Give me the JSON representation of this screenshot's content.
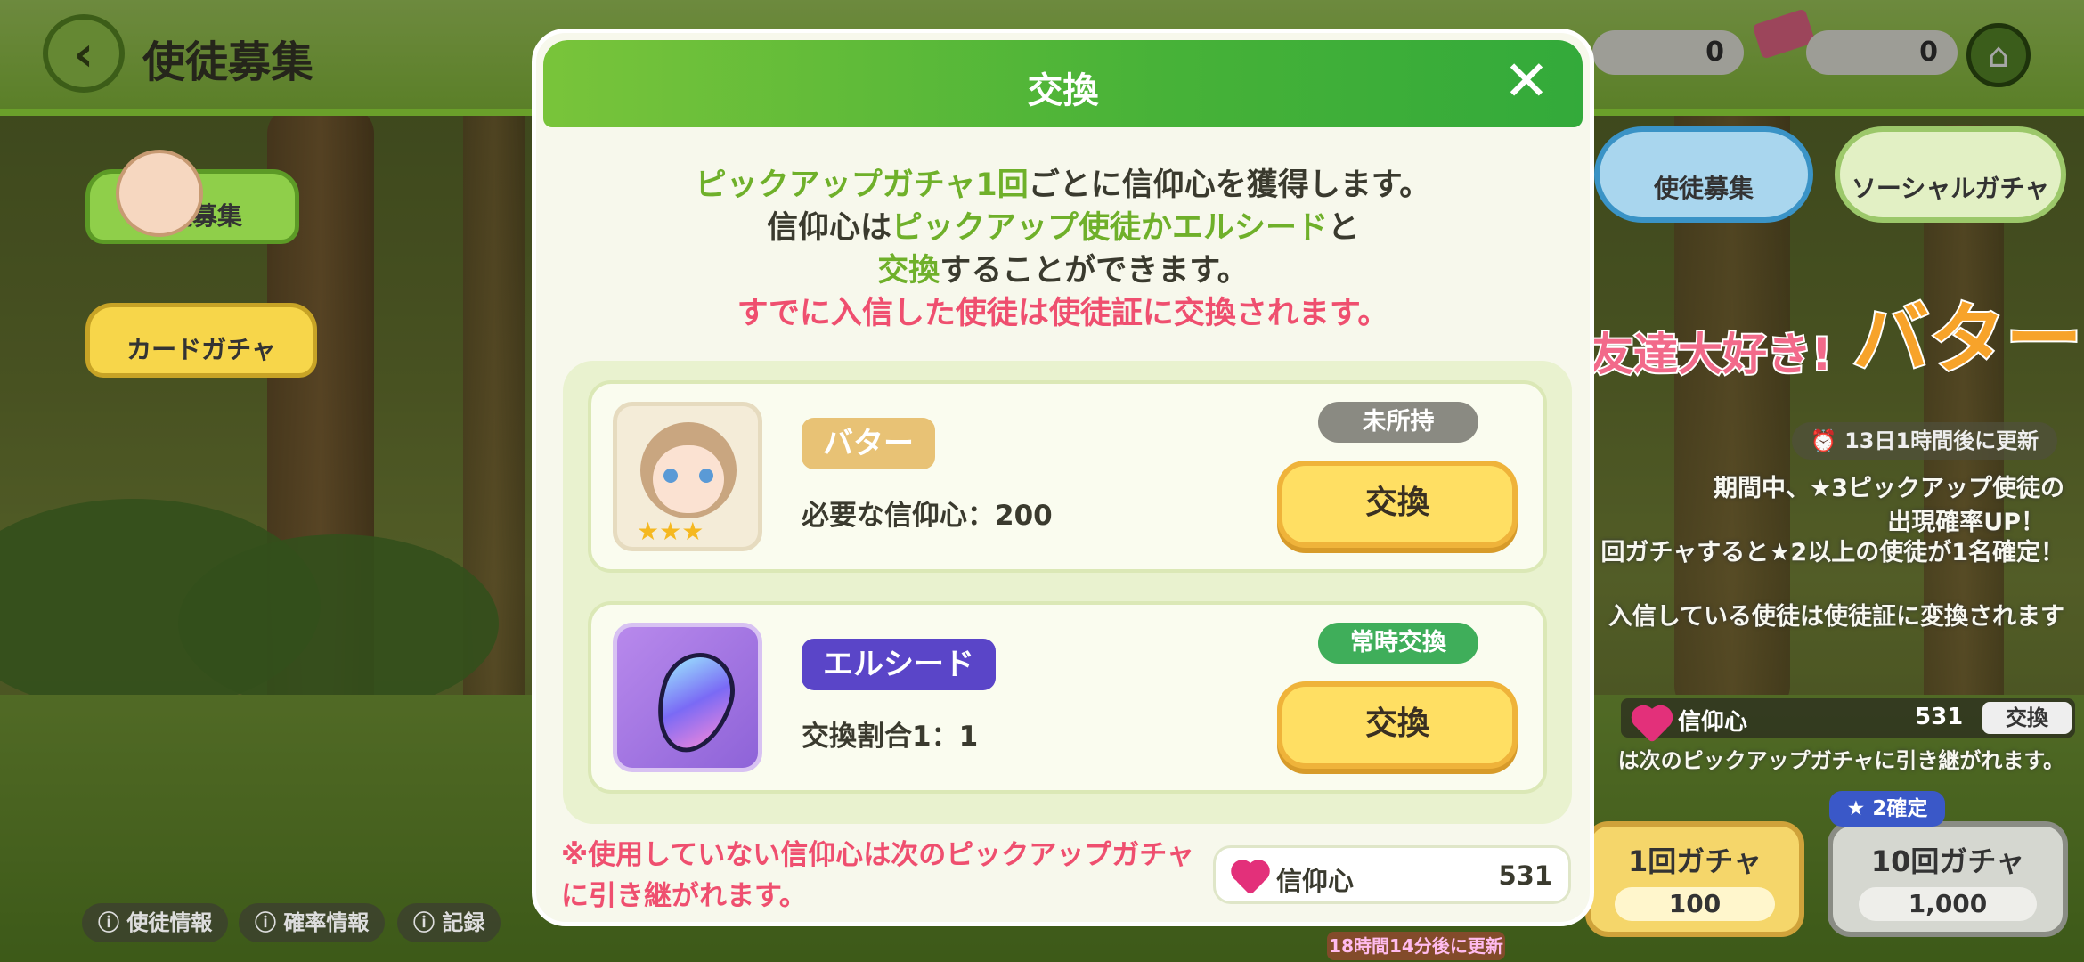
{
  "header": {
    "title": "使徒募集",
    "counters": [
      "0",
      "0"
    ]
  },
  "left_menu": {
    "recruit_label": "使徒募集",
    "card_gacha_label": "カードガチャ"
  },
  "right_tabs": {
    "recruit_label": "使徒募集",
    "social_label": "ソーシャルガチャ"
  },
  "banner": {
    "text_left": "友達大好き!",
    "text_right": "バター",
    "timer": "13日1時間後に更新",
    "line1": "期間中、★3ピックアップ使徒の",
    "line2": "出現確率UP！",
    "line3": "回ガチャすると★2以上の使徒が1名確定！",
    "line4": "入信している使徒は使徒証に変換されます",
    "faith_label": "信仰心",
    "faith_value": "531",
    "faith_button": "交換",
    "carry_note": "は次のピックアップガチャに引き継がれます。"
  },
  "gacha": {
    "single_label": "1回ガチャ",
    "single_cost": "100",
    "multi_label": "10回ガチャ",
    "multi_cost": "1,000",
    "multi_badge": "2確定",
    "update_timer": "18時間14分後に更新"
  },
  "bottom_links": [
    "使徒情報",
    "確率情報",
    "記録"
  ],
  "modal": {
    "title": "交換",
    "close": "✕",
    "desc1_a": "ピックアップガチャ1回",
    "desc1_b": "ごとに信仰心を獲得します。",
    "desc2_a": "信仰心は",
    "desc2_b": "ピックアップ使徒かエルシード",
    "desc2_c": "と",
    "desc3_a": "交換",
    "desc3_b": "することができます。",
    "desc4": "すでに入信した使徒は使徒証に交換されます。",
    "items": [
      {
        "name": "バター",
        "requirement": "必要な信仰心：200",
        "status": "未所持",
        "button": "交換"
      },
      {
        "name": "エルシード",
        "requirement": "交換割合1：1",
        "status": "常時交換",
        "button": "交換"
      }
    ],
    "note_line1": "※使用していない信仰心は次のピックアップガチャ",
    "note_line2": "に引き継がれます。",
    "faith_label": "信仰心",
    "faith_value": "531"
  },
  "colors": {
    "header_green": "#47b238",
    "accent_green": "#6fb02a",
    "warning_pink": "#ef4f6f",
    "butter_badge": "#e8c275",
    "elseed_badge": "#5a45c8",
    "status_grey": "#8a8a82",
    "status_green": "#3fae5a",
    "exchange_button": "#ffdf63"
  }
}
